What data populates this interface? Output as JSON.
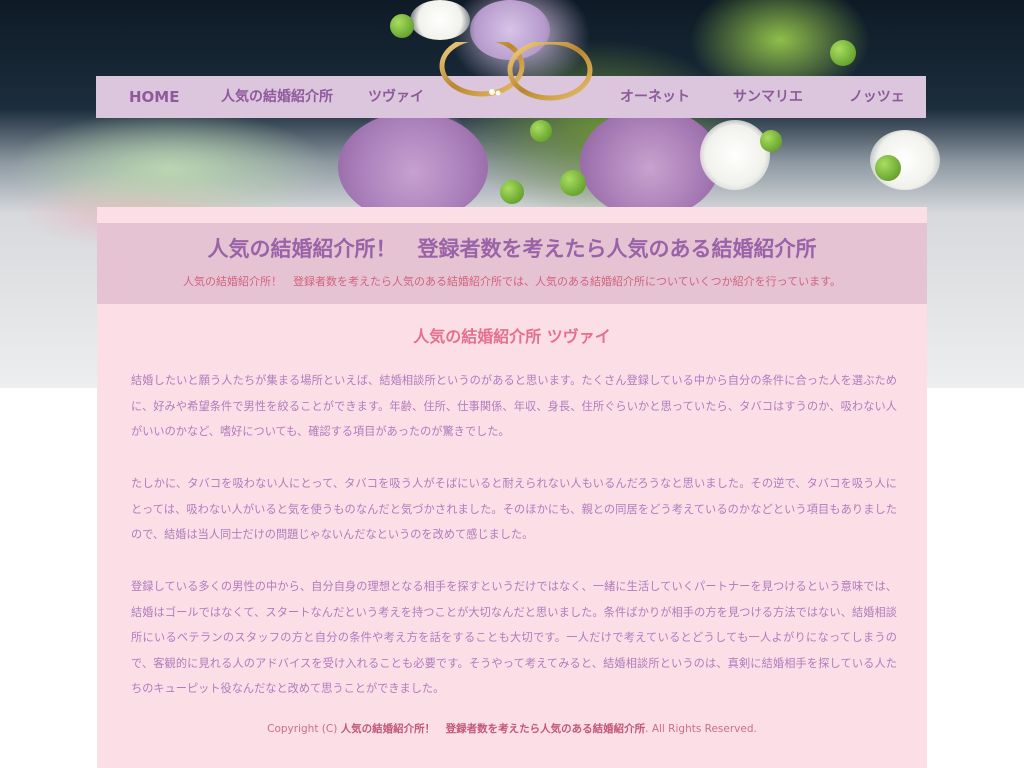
{
  "nav": {
    "items": [
      {
        "id": "home",
        "label": "HOME"
      },
      {
        "id": "ninki",
        "label": "人気の結婚紹介所"
      },
      {
        "id": "zwei",
        "label": "ツヴァイ"
      },
      {
        "id": "onet",
        "label": "オーネット"
      },
      {
        "id": "sunmarie",
        "label": "サンマリエ"
      },
      {
        "id": "nozze",
        "label": "ノッツェ"
      }
    ]
  },
  "header": {
    "title": "人気の結婚紹介所！　登録者数を考えたら人気のある結婚紹介所",
    "description": "人気の結婚紹介所！　登録者数を考えたら人気のある結婚紹介所では、人気のある結婚紹介所についていくつか紹介を行っています。"
  },
  "main": {
    "section_title": "人気の結婚紹介所 ツヴァイ",
    "paragraphs": [
      "結婚したいと願う人たちが集まる場所といえば、結婚相談所というのがあると思います。たくさん登録している中から自分の条件に合った人を選ぶために、好みや希望条件で男性を絞ることができます。年齢、住所、仕事関係、年収、身長、住所ぐらいかと思っていたら、タバコはすうのか、吸わない人がいいのかなど、嗜好についても、確認する項目があったのが驚きでした。",
      "たしかに、タバコを吸わない人にとって、タバコを吸う人がそばにいると耐えられない人もいるんだろうなと思いました。その逆で、タバコを吸う人にとっては、吸わない人がいると気を使うものなんだと気づかされました。そのほかにも、親との同居をどう考えているのかなどという項目もありましたので、結婚は当人同士だけの問題じゃないんだなというのを改めて感じました。",
      "登録している多くの男性の中から、自分自身の理想となる相手を探すというだけではなく、一緒に生活していくパートナーを見つけるという意味では、結婚はゴールではなくて、スタートなんだという考えを持つことが大切なんだと思いました。条件ばかりが相手の方を見つける方法ではない、結婚相談所にいるベテランのスタッフの方と自分の条件や考え方を話をすることも大切です。一人だけで考えているとどうしても一人よがりになってしまうので、客観的に見れる人のアドバイスを受け入れることも必要です。そうやって考えてみると、結婚相談所というのは、真剣に結婚相手を探している人たちのキューピット役なんだなと改めて思うことができました。"
    ]
  },
  "footer": {
    "prefix": "Copyright (C)",
    "site_name": "人気の結婚紹介所！　登録者数を考えたら人気のある結婚紹介所",
    "suffix": ". All Rights Reserved."
  },
  "colors": {
    "nav_bg": "#dcc6dd",
    "nav_text": "#8e5a9a",
    "content_bg": "#fcdfe6",
    "header_band": "#e5c3d3",
    "title_purple": "#9a63a8",
    "accent_pink": "#e46f8f",
    "body_text": "#b07bbd"
  },
  "icons": {
    "nav_decoration": "wedding-rings-icon"
  }
}
